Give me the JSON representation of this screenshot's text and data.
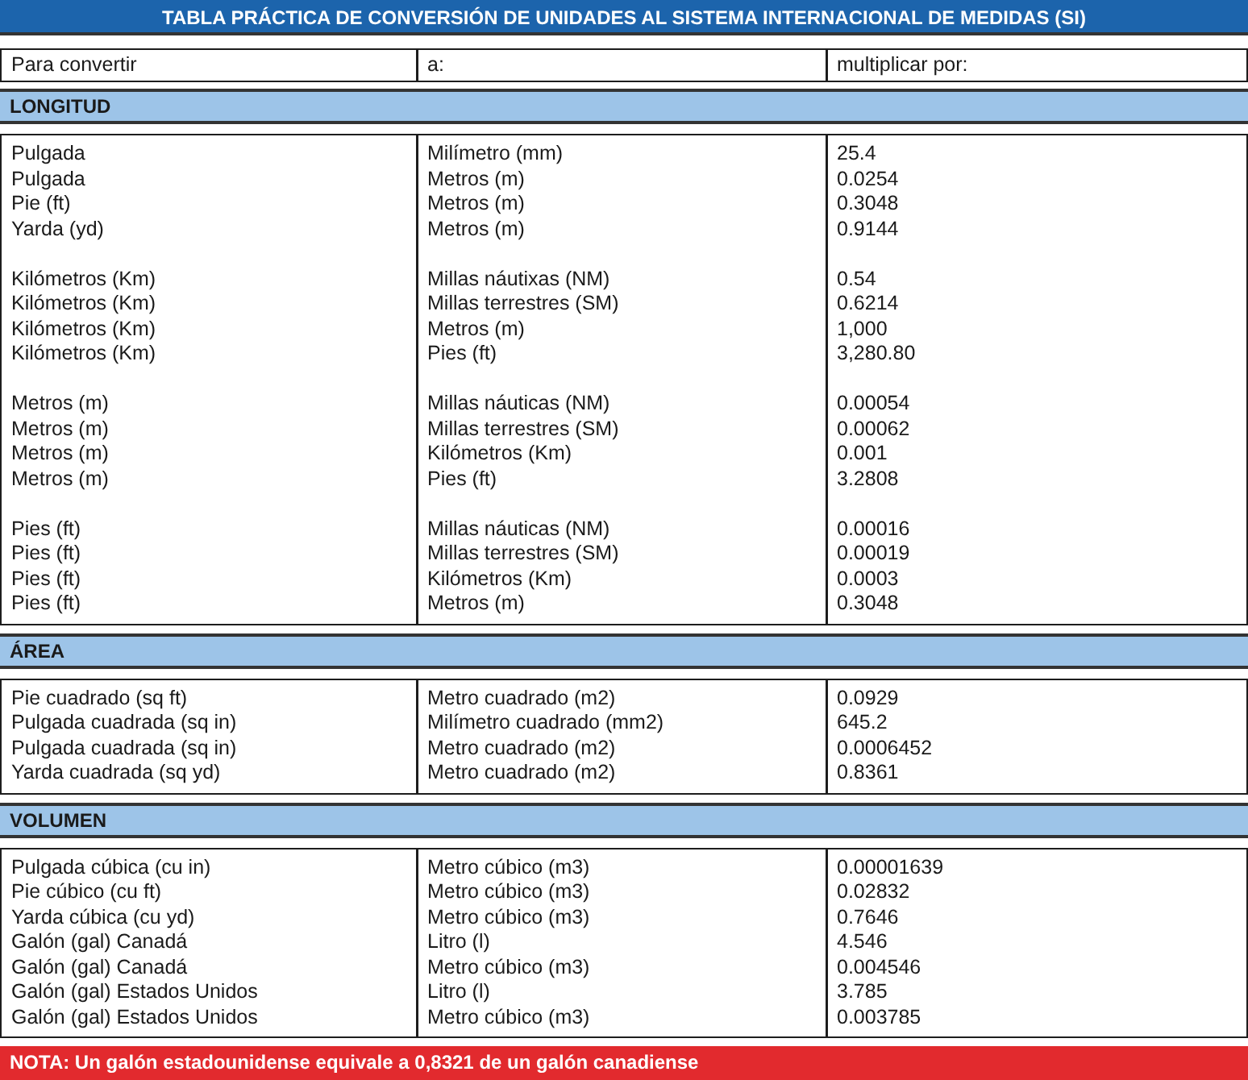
{
  "title": "TABLA PRÁCTICA DE CONVERSIÓN DE UNIDADES AL SISTEMA INTERNACIONAL DE MEDIDAS (SI)",
  "columns": [
    "Para convertir",
    "a:",
    "multiplicar por:"
  ],
  "sections": [
    {
      "heading": "LONGITUD",
      "groups": [
        {
          "rows": [
            [
              "Pulgada",
              "Milímetro (mm)",
              "25.4"
            ],
            [
              "Pulgada",
              "Metros (m)",
              "0.0254"
            ],
            [
              "Pie (ft)",
              "Metros (m)",
              "0.3048"
            ],
            [
              "Yarda (yd)",
              "Metros (m)",
              "0.9144"
            ]
          ]
        },
        {
          "rows": [
            [
              "Kilómetros (Km)",
              "Millas náutixas (NM)",
              "0.54"
            ],
            [
              "Kilómetros (Km)",
              "Millas terrestres (SM)",
              "0.6214"
            ],
            [
              "Kilómetros (Km)",
              "Metros (m)",
              "1,000"
            ],
            [
              "Kilómetros (Km)",
              "Pies (ft)",
              "3,280.80"
            ]
          ]
        },
        {
          "rows": [
            [
              "Metros (m)",
              "Millas náuticas (NM)",
              "0.00054"
            ],
            [
              "Metros (m)",
              "Millas terrestres (SM)",
              "0.00062"
            ],
            [
              "Metros (m)",
              "Kilómetros (Km)",
              "0.001"
            ],
            [
              "Metros (m)",
              "Pies (ft)",
              "3.2808"
            ]
          ]
        },
        {
          "rows": [
            [
              "Pies (ft)",
              "Millas náuticas (NM)",
              "0.00016"
            ],
            [
              "Pies (ft)",
              "Millas terrestres (SM)",
              "0.00019"
            ],
            [
              "Pies (ft)",
              "Kilómetros (Km)",
              "0.0003"
            ],
            [
              "Pies (ft)",
              "Metros (m)",
              "0.3048"
            ]
          ]
        }
      ]
    },
    {
      "heading": "ÁREA",
      "groups": [
        {
          "rows": [
            [
              "Pie cuadrado (sq ft)",
              "Metro cuadrado (m2)",
              "0.0929"
            ],
            [
              "Pulgada cuadrada (sq in)",
              "Milímetro cuadrado (mm2)",
              "645.2"
            ],
            [
              "Pulgada cuadrada (sq in)",
              "Metro cuadrado (m2)",
              "0.0006452"
            ],
            [
              "Yarda cuadrada (sq yd)",
              "Metro cuadrado (m2)",
              "0.8361"
            ]
          ]
        }
      ]
    },
    {
      "heading": "VOLUMEN",
      "groups": [
        {
          "rows": [
            [
              "Pulgada cúbica (cu in)",
              "Metro cúbico (m3)",
              "0.00001639"
            ],
            [
              "Pie cúbico (cu ft)",
              "Metro cúbico (m3)",
              "0.02832"
            ],
            [
              "Yarda cúbica (cu yd)",
              "Metro cúbico (m3)",
              "0.7646"
            ],
            [
              "Galón (gal) Canadá",
              "Litro (l)",
              "4.546"
            ],
            [
              "Galón (gal) Canadá",
              "Metro cúbico (m3)",
              "0.004546"
            ],
            [
              "Galón (gal) Estados Unidos",
              "Litro (l)",
              "3.785"
            ],
            [
              "Galón (gal) Estados Unidos",
              "Metro cúbico (m3)",
              "0.003785"
            ]
          ]
        }
      ]
    }
  ],
  "note": "NOTA: Un galón estadounidense equivale a 0,8321 de un galón canadiense"
}
